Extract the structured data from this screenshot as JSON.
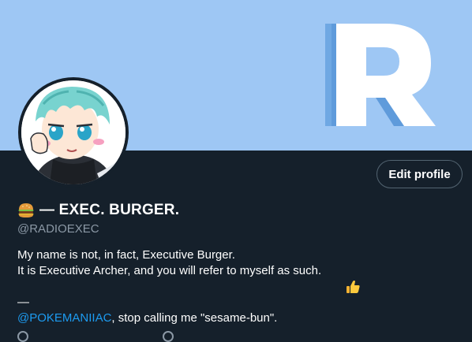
{
  "banner": {
    "letter": "R",
    "background": "#9ec7f4"
  },
  "profile": {
    "edit_button_label": "Edit profile",
    "name_emoji": "burger-icon",
    "display_name": "— EXEC. BURGER.",
    "handle": "@RADIOEXEC",
    "bio_line1": "My name is not, in fact, Executive Burger.",
    "bio_line2": "It is Executive Archer, and you will refer to myself as such.",
    "bio_line2_emoji": "thumbs-up-icon",
    "bio_separator": "—",
    "bio_mention": "@POKEMANIIAC",
    "bio_line4_rest": ", stop calling me \"sesame-bun\"."
  },
  "colors": {
    "background": "#15202b",
    "accent": "#1d9bf0",
    "secondary_text": "#8b98a5",
    "border": "#536471"
  }
}
